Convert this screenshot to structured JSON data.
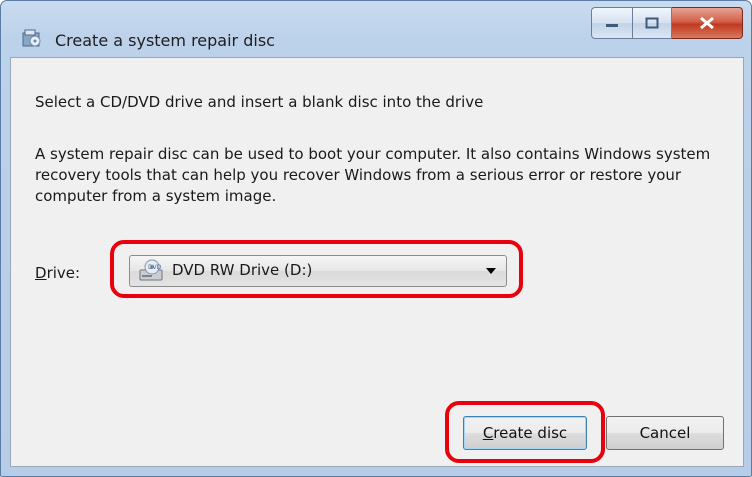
{
  "window": {
    "title": "Create a system repair disc"
  },
  "content": {
    "instruction": "Select a CD/DVD drive and insert a blank disc into the drive",
    "description": "A system repair disc can be used to boot your computer. It also contains Windows system recovery tools that can help you recover Windows from a serious error or restore your computer from a system image."
  },
  "drive": {
    "label_accel": "D",
    "label_rest": "rive:",
    "selected": "DVD RW Drive (D:)",
    "icon": "dvd-drive-icon"
  },
  "buttons": {
    "create_accel": "C",
    "create_rest": "reate disc",
    "cancel": "Cancel"
  },
  "colors": {
    "highlight": "#e8000d",
    "close_button": "#c0391f"
  }
}
